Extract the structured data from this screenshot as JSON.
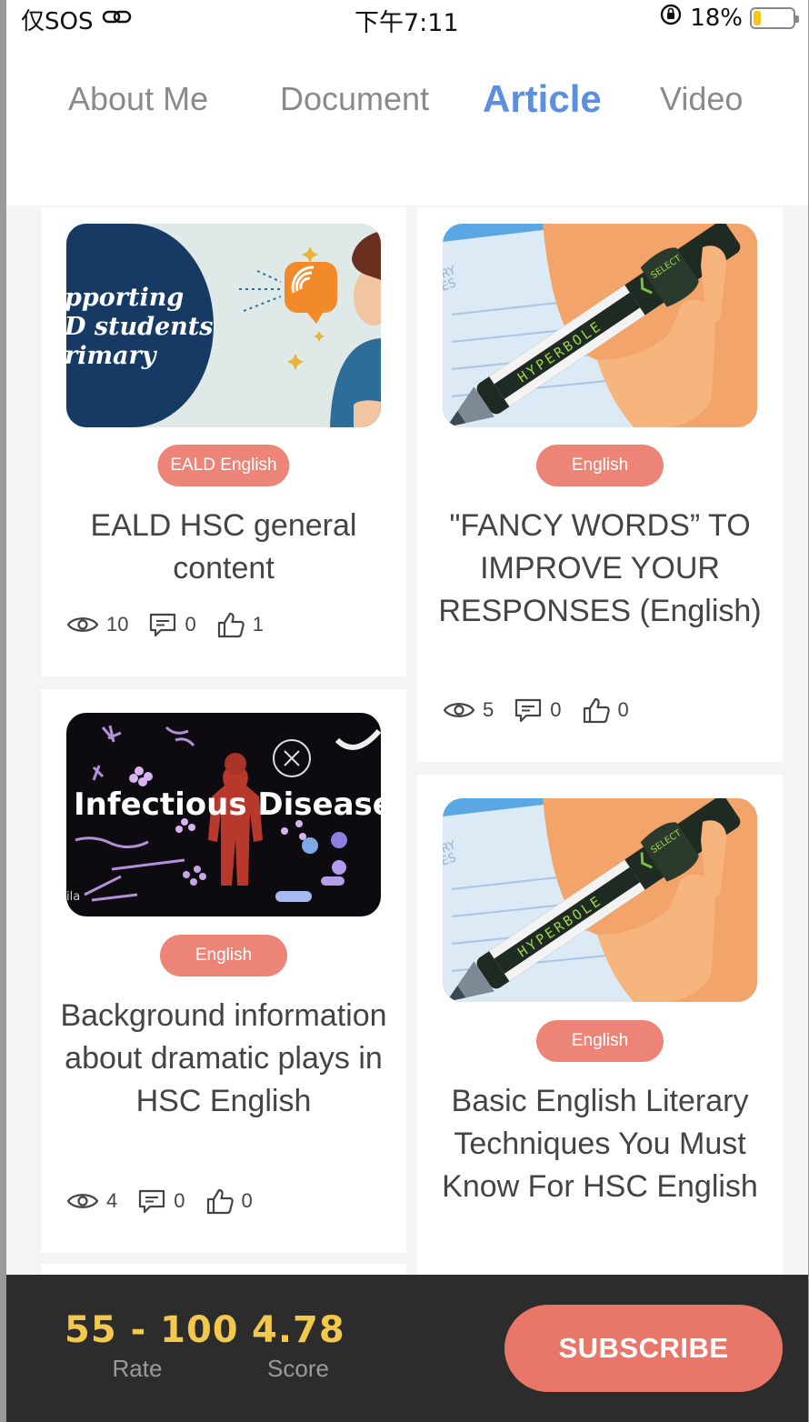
{
  "status_bar": {
    "carrier": "仅SOS",
    "time": "下午7:11",
    "battery_percent": "18%",
    "battery_level": 0.18,
    "icons": [
      "link-icon",
      "orientation-lock-icon",
      "battery-icon"
    ]
  },
  "tabs": [
    {
      "label": "About Me",
      "active": false
    },
    {
      "label": "Document",
      "active": false
    },
    {
      "label": "Article",
      "active": true
    },
    {
      "label": "Video",
      "active": false
    }
  ],
  "articles": [
    {
      "thumb_text": [
        "pporting",
        "D students",
        "rimary"
      ],
      "tag": "EALD English",
      "title": "EALD HSC general content",
      "views": "10",
      "comments": "0",
      "likes": "1"
    },
    {
      "thumb_text": [
        "HYPERBOLE",
        "SELECT",
        "RY",
        "ES"
      ],
      "tag": "English",
      "title": "\"FANCY WORDS” TO IMPROVE YOUR RESPONSES (English)",
      "views": "5",
      "comments": "0",
      "likes": "0"
    },
    {
      "thumb_text": [
        "Infectious Diseases",
        "ila"
      ],
      "tag": "English",
      "title": "Background information about dramatic plays in HSC English",
      "views": "4",
      "comments": "0",
      "likes": "0"
    },
    {
      "thumb_text": [
        "HYPERBOLE",
        "SELECT",
        "RY",
        "ES"
      ],
      "tag": "English",
      "title": "Basic English Literary Techniques You Must Know For HSC English"
    }
  ],
  "bottom_bar": {
    "rate_value": "55 - 100",
    "rate_label": "Rate",
    "score_value": "4.78",
    "score_label": "Score",
    "subscribe_label": "SUBSCRIBE"
  },
  "colors": {
    "active_tab": "#5b8fe0",
    "tag": "#ec8577",
    "subscribe": "#e8776a",
    "metric": "#f2c94c",
    "bottom_bar": "#2c2c2c"
  }
}
